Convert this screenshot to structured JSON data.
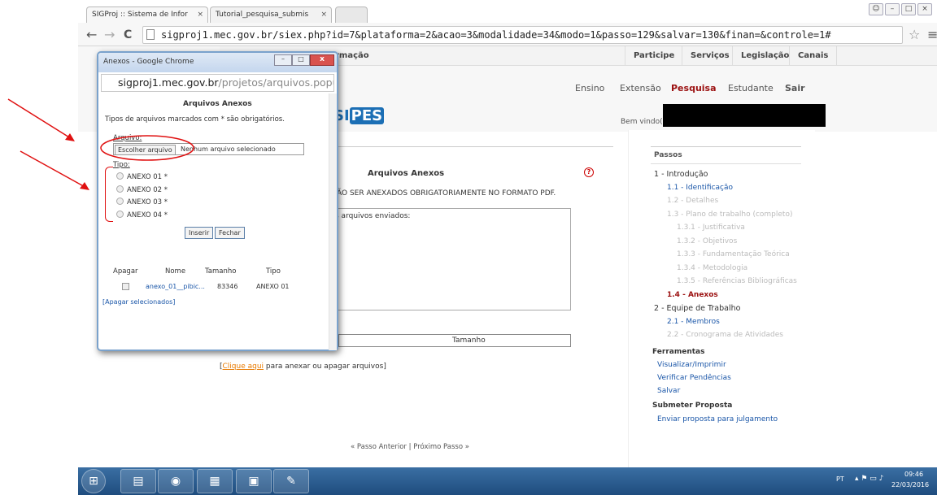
{
  "browser": {
    "tabs": [
      {
        "title": "SIGProj :: Sistema de Infor",
        "close": "×"
      },
      {
        "title": "Tutorial_pesquisa_submis",
        "close": "×"
      }
    ],
    "url": "sigproj1.mec.gov.br/siex.php?id=7&plataforma=2&acao=3&modalidade=34&modo=1&passo=129&salvar=130&finan=&controle=1#",
    "back": "←",
    "forward": "→",
    "reload": "C",
    "star": "☆",
    "menu": "≡"
  },
  "site": {
    "topnav": [
      "Participe",
      "Serviços",
      "Legislação",
      "Canais"
    ],
    "topnav_left": "rmação",
    "menu": [
      "Ensino",
      "Extensão",
      "Pesquisa",
      "Estudante",
      "Sair"
    ],
    "logo": "PES",
    "logo_prefix": "SI",
    "welcome": "Bem vindo(a"
  },
  "main": {
    "section_title": "Arquivos Anexos",
    "notice": "ÃO SER ANEXADOS OBRIGATORIAMENTE NO FORMATO PDF.",
    "box_label": "s arquivos enviados:",
    "table_header": "Tamanho",
    "link_pre": "[",
    "link": "Clique aqui",
    "link_post": " para anexar ou apagar arquivos]",
    "pager_prev": "« Passo Anterior",
    "pager_sep": "|",
    "pager_next": "Próximo Passo »"
  },
  "steps": {
    "title": "Passos",
    "items": [
      {
        "label": "1 - Introdução",
        "style": "blk"
      },
      {
        "label": "1.1 - Identificação",
        "style": "blue"
      },
      {
        "label": "1.2 - Detalhes",
        "style": "gr"
      },
      {
        "label": "1.3 - Plano de trabalho (completo)",
        "style": "gr"
      },
      {
        "label": "1.3.1 - Justificativa",
        "style": "gr"
      },
      {
        "label": "1.3.2 - Objetivos",
        "style": "gr"
      },
      {
        "label": "1.3.3 - Fundamentação Teórica",
        "style": "gr"
      },
      {
        "label": "1.3.4 - Metodologia",
        "style": "gr"
      },
      {
        "label": "1.3.5 - Referências Bibliográficas",
        "style": "gr"
      },
      {
        "label": "1.4 - Anexos",
        "style": "red"
      },
      {
        "label": "2 - Equipe de Trabalho",
        "style": "blk"
      },
      {
        "label": "2.1 - Membros",
        "style": "blue"
      },
      {
        "label": "2.2 - Cronograma de Atividades",
        "style": "gr"
      }
    ],
    "tools_title": "Ferramentas",
    "tools": [
      "Visualizar/Imprimir",
      "Verificar Pendências",
      "Salvar"
    ],
    "submit_title": "Submeter Proposta",
    "submit_link": "Enviar proposta para julgamento"
  },
  "popup": {
    "title": "Anexos - Google Chrome",
    "url_host": "sigproj1.mec.gov.br",
    "url_path": "/projetos/arquivos.popup.p",
    "heading": "Arquivos Anexos",
    "subtitle": "Tipos de arquivos marcados com * são obrigatórios.",
    "file_label": "Arquivo:",
    "file_button": "Escolher arquivo",
    "file_status": "Nenhum arquivo selecionado",
    "type_label": "Tipo:",
    "types": [
      "ANEXO 01 *",
      "ANEXO 02 *",
      "ANEXO 03 *",
      "ANEXO 04 *"
    ],
    "insert": "Inserir",
    "close": "Fechar",
    "cols": [
      "Apagar",
      "Nome",
      "Tamanho",
      "Tipo"
    ],
    "row": {
      "name": "anexo_01__pibic...",
      "size": "83346",
      "type": "ANEXO 01"
    },
    "delete_selected": "[Apagar selecionados]"
  },
  "taskbar": {
    "lang": "PT",
    "time": "09:46",
    "date": "22/03/2016"
  },
  "colors": {
    "accent_red": "#9b1010",
    "link_blue": "#1a56a8",
    "arrow": "#e01010"
  }
}
